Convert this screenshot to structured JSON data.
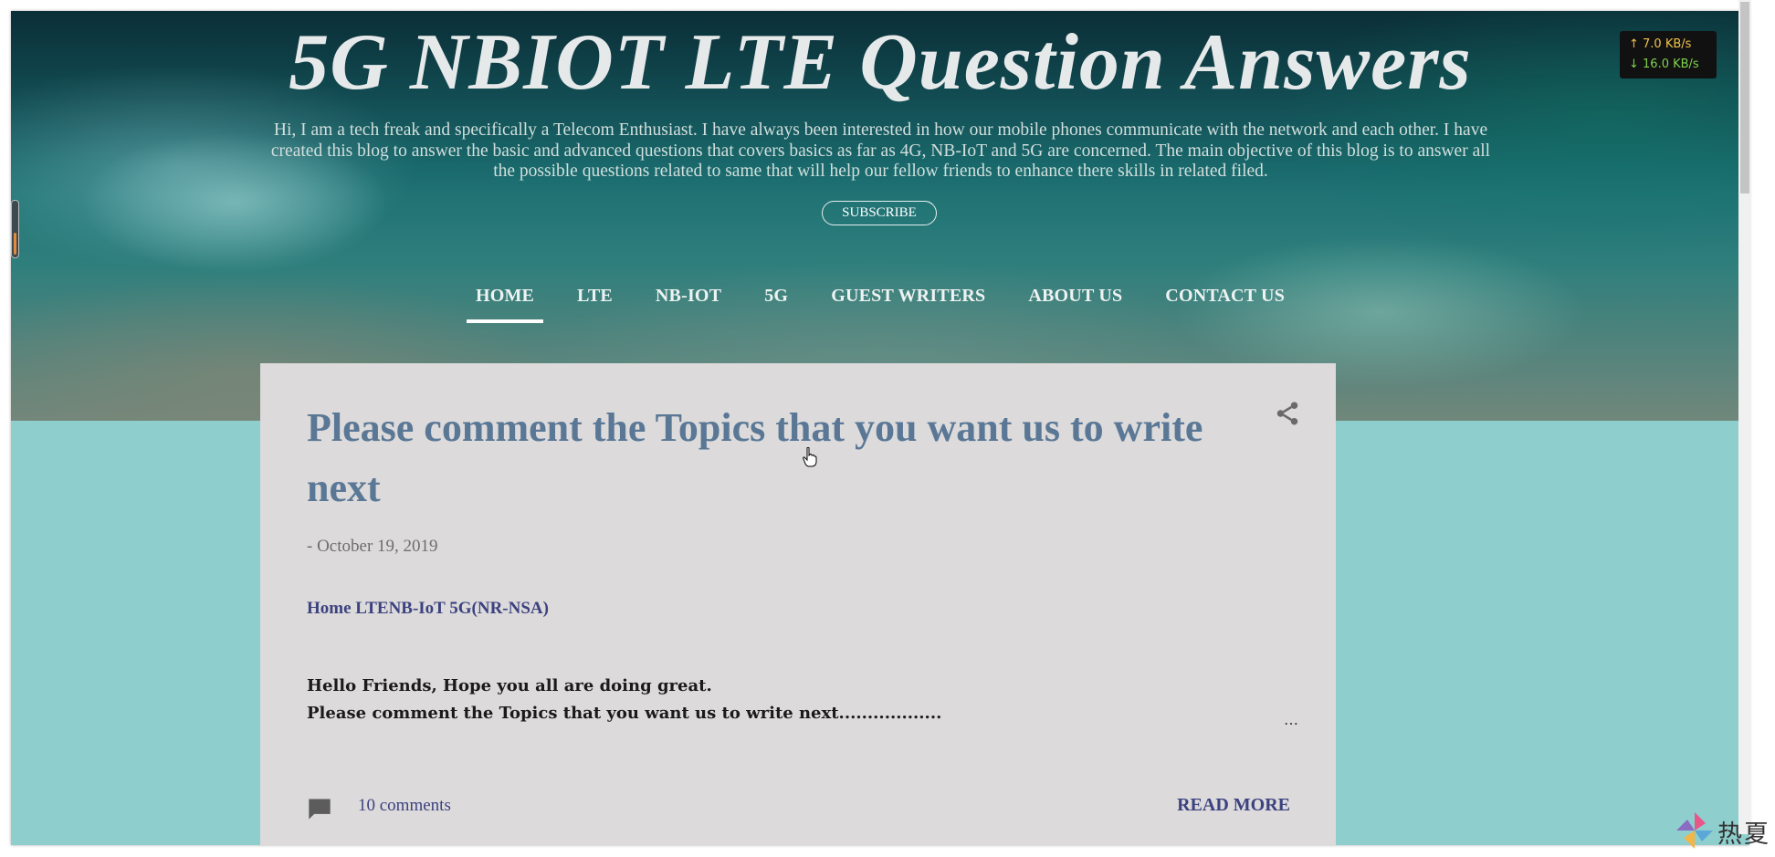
{
  "header": {
    "title": "5G NBIOT LTE Question Answers",
    "description": "Hi, I am a tech freak and specifically a Telecom Enthusiast. I have always been interested in how our mobile phones communicate with the network and each other. I have created this blog to answer the basic and advanced questions that covers basics as far as 4G, NB-IoT and 5G are concerned. The main objective of this blog is to answer all the possible questions related to same that will help our fellow friends to enhance there skills in related filed.",
    "subscribe_label": "SUBSCRIBE"
  },
  "nav": {
    "items": [
      {
        "label": "HOME",
        "active": true
      },
      {
        "label": "LTE"
      },
      {
        "label": "NB-IOT"
      },
      {
        "label": "5G"
      },
      {
        "label": "GUEST WRITERS"
      },
      {
        "label": "ABOUT US"
      },
      {
        "label": "CONTACT US"
      }
    ]
  },
  "post": {
    "title": "Please comment the Topics that you want us to write next",
    "date": "- October 19, 2019",
    "links": "Home LTENB-IoT 5G(NR-NSA)",
    "body_line1": "Hello Friends, Hope you all are doing great.",
    "body_line2": "Please comment the Topics that you want us to write next..................",
    "ellipsis": "…",
    "comments": "10 comments",
    "read_more": "READ MORE"
  },
  "net_speed": {
    "up": "↑ 7.0 KB/s",
    "down": "↓ 16.0 KB/s"
  },
  "brand": {
    "text": "热夏"
  },
  "colors": {
    "page_background": "#8ecfce",
    "card_background": "#dcdada",
    "post_title": "#5a7896",
    "link": "#3c4280"
  },
  "icons": {
    "share": "share-icon",
    "comment": "comment-icon",
    "cursor": "hand-cursor-icon"
  }
}
